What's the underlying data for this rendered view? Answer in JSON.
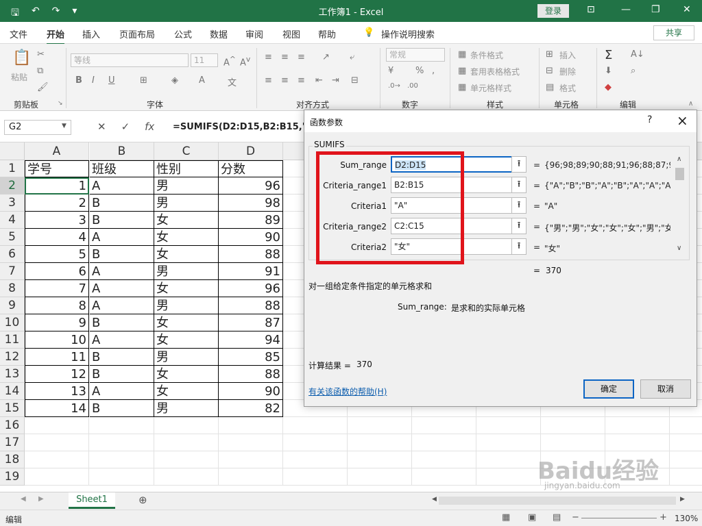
{
  "window": {
    "title": "工作簿1 - Excel",
    "login_label": "登录",
    "share_label": "共享"
  },
  "ribbon_tabs": [
    "文件",
    "开始",
    "插入",
    "页面布局",
    "公式",
    "数据",
    "审阅",
    "视图",
    "帮助",
    "操作说明搜索"
  ],
  "ribbon_groups": {
    "clipboard": "剪贴板",
    "font": "字体",
    "alignment": "对齐方式",
    "number": "数字",
    "styles": "样式",
    "cells": "单元格",
    "editing": "编辑"
  },
  "ribbon_items": {
    "paste": "粘贴",
    "font_name": "等线",
    "font_size": "11",
    "number_format": "常规",
    "conditional_format": "条件格式",
    "table_format": "套用表格格式",
    "cell_style": "单元格样式",
    "insert": "插入",
    "delete": "删除",
    "format": "格式"
  },
  "formula_bar": {
    "name_box": "G2",
    "formula": "=SUMIFS(D2:D15,B2:B15,\"A\",C"
  },
  "grid": {
    "columns": [
      "A",
      "B",
      "C",
      "D"
    ],
    "row_numbers": [
      "1",
      "2",
      "3",
      "4",
      "5",
      "6",
      "7",
      "8",
      "9",
      "10",
      "11",
      "12",
      "13",
      "14",
      "15",
      "16",
      "17",
      "18",
      "19"
    ],
    "headers": [
      "学号",
      "班级",
      "性别",
      "分数"
    ],
    "rows": [
      [
        "1",
        "A",
        "男",
        "96"
      ],
      [
        "2",
        "B",
        "男",
        "98"
      ],
      [
        "3",
        "B",
        "女",
        "89"
      ],
      [
        "4",
        "A",
        "女",
        "90"
      ],
      [
        "5",
        "B",
        "女",
        "88"
      ],
      [
        "6",
        "A",
        "男",
        "91"
      ],
      [
        "7",
        "A",
        "女",
        "96"
      ],
      [
        "8",
        "A",
        "男",
        "88"
      ],
      [
        "9",
        "B",
        "女",
        "87"
      ],
      [
        "10",
        "A",
        "女",
        "94"
      ],
      [
        "11",
        "B",
        "男",
        "85"
      ],
      [
        "12",
        "B",
        "女",
        "88"
      ],
      [
        "13",
        "A",
        "女",
        "90"
      ],
      [
        "14",
        "B",
        "男",
        "82"
      ]
    ]
  },
  "sheet_tab": "Sheet1",
  "status": {
    "mode": "编辑",
    "zoom": "130%"
  },
  "dialog": {
    "title": "函数参数",
    "help_q": "?",
    "function_name": "SUMIFS",
    "args": [
      {
        "label": "Sum_range",
        "value": "D2:D15",
        "result": "{96;98;89;90;88;91;96;88;87;94..."
      },
      {
        "label": "Criteria_range1",
        "value": "B2:B15",
        "result": "{\"A\";\"B\";\"B\";\"A\";\"B\";\"A\";\"A\";\"A\"..."
      },
      {
        "label": "Criteria1",
        "value": "\"A\"",
        "result": "\"A\""
      },
      {
        "label": "Criteria_range2",
        "value": "C2:C15",
        "result": "{\"男\";\"男\";\"女\";\"女\";\"女\";\"男\";\"女\"..."
      },
      {
        "label": "Criteria2",
        "value": "\"女\"",
        "result": "\"女\""
      }
    ],
    "total_result": "370",
    "description": "对一组给定条件指定的单元格求和",
    "arg_help_name": "Sum_range:",
    "arg_help_text": "是求和的实际单元格",
    "calc_label": "计算结果 =",
    "calc_value": "370",
    "help_link": "有关该函数的帮助(H)",
    "ok_label": "确定",
    "cancel_label": "取消"
  },
  "watermark": {
    "text": "Baidu经验",
    "sub": "jingyan.baidu.com"
  }
}
